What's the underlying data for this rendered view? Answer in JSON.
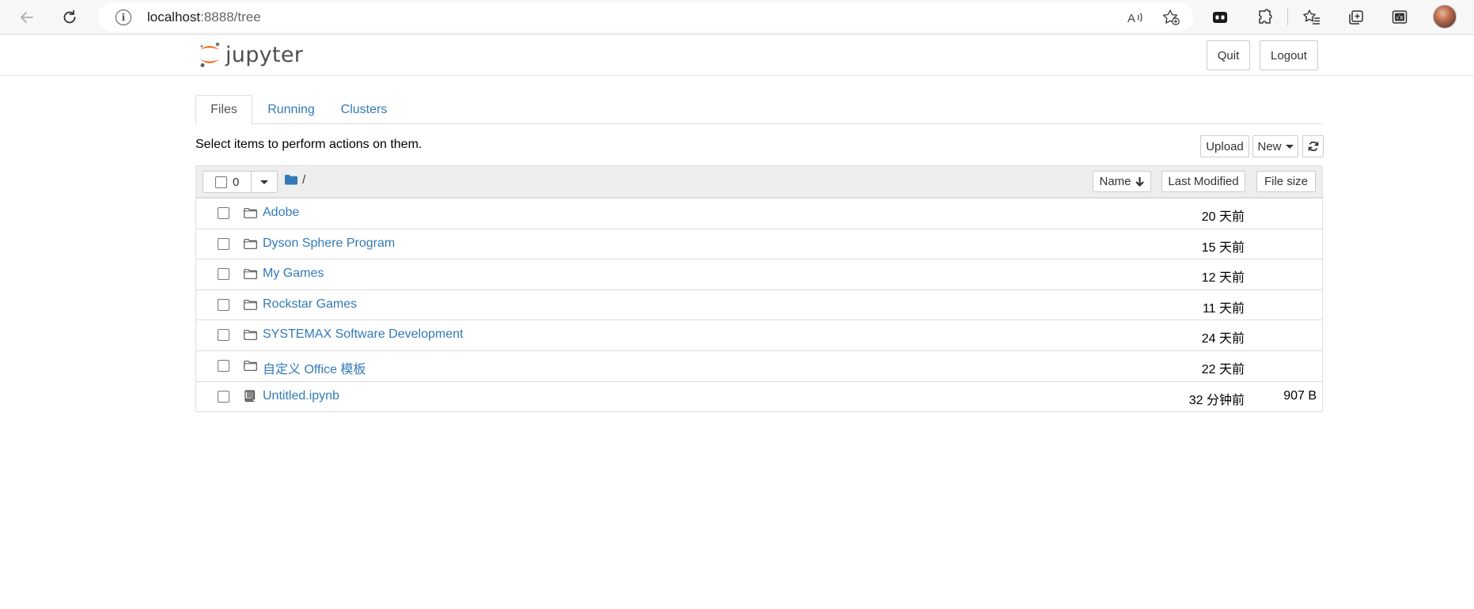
{
  "browser": {
    "url_host": "localhost",
    "url_path": ":8888/tree",
    "info_icon": "info-icon",
    "read_aloud_icon": "read-aloud-icon",
    "favorite_add_icon": "favorite-add-icon",
    "toolbar_icons": [
      "gamepad-icon",
      "extensions-icon",
      "favorites-icon",
      "collections-icon",
      "math-solver-icon"
    ]
  },
  "header": {
    "logo_text": "jupyter",
    "quit_label": "Quit",
    "logout_label": "Logout"
  },
  "tabs": [
    {
      "label": "Files",
      "active": true
    },
    {
      "label": "Running",
      "active": false
    },
    {
      "label": "Clusters",
      "active": false
    }
  ],
  "toolbar": {
    "instructions": "Select items to perform actions on them.",
    "upload_label": "Upload",
    "new_label": "New",
    "refresh_icon": "refresh-icon"
  },
  "list_header": {
    "selected_count": "0",
    "breadcrumb": "/",
    "name_label": "Name",
    "last_modified_label": "Last Modified",
    "file_size_label": "File size"
  },
  "items": [
    {
      "name": "Adobe",
      "type": "folder",
      "modified": "20 天前",
      "size": ""
    },
    {
      "name": "Dyson Sphere Program",
      "type": "folder",
      "modified": "15 天前",
      "size": ""
    },
    {
      "name": "My Games",
      "type": "folder",
      "modified": "12 天前",
      "size": ""
    },
    {
      "name": "Rockstar Games",
      "type": "folder",
      "modified": "11 天前",
      "size": ""
    },
    {
      "name": "SYSTEMAX Software Development",
      "type": "folder",
      "modified": "24 天前",
      "size": ""
    },
    {
      "name": "自定义 Office 模板",
      "type": "folder",
      "modified": "22 天前",
      "size": ""
    },
    {
      "name": "Untitled.ipynb",
      "type": "notebook",
      "modified": "32 分钟前",
      "size": "907 B"
    }
  ],
  "colors": {
    "link": "#337ab7",
    "jupyter_orange": "#f37726",
    "header_bg": "#eeeeee"
  }
}
